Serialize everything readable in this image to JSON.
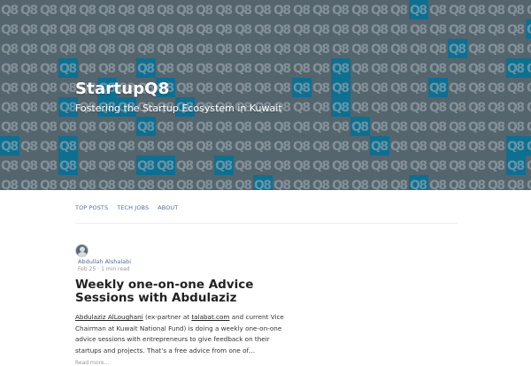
{
  "site": {
    "title": "StartupQ8",
    "tagline": "Fostering the Startup Ecosystem in Kuwait",
    "pattern_text": "Q8",
    "colors": {
      "hero_base": "#54656e",
      "hero_tile": "#0f6f90",
      "pattern_text": "#a9b4ba",
      "link": "#4f6f9a"
    }
  },
  "nav": {
    "items": [
      {
        "label": "TOP POSTS"
      },
      {
        "label": "TECH JOBS"
      },
      {
        "label": "ABOUT"
      }
    ]
  },
  "post": {
    "author": "Abdullah Alshalabi",
    "avatar_icon": "user-avatar-icon",
    "date": "Feb 25",
    "separator": "·",
    "read_time": "1 min read",
    "title": "Weekly one-on-one Advice Sessions with Abdulaziz",
    "excerpt": {
      "link1": "Abdulaziz AlLoughani",
      "text1": " (ex-partner at ",
      "link2": "talabat.com",
      "text2": " and current Vice Chairman at Kuwait National Fund) is doing a weekly one-on-one advice sessions with entrepreneurs to give feedback on their startups and projects. That’s a free advice from one of…"
    },
    "read_more": "Read more…"
  }
}
